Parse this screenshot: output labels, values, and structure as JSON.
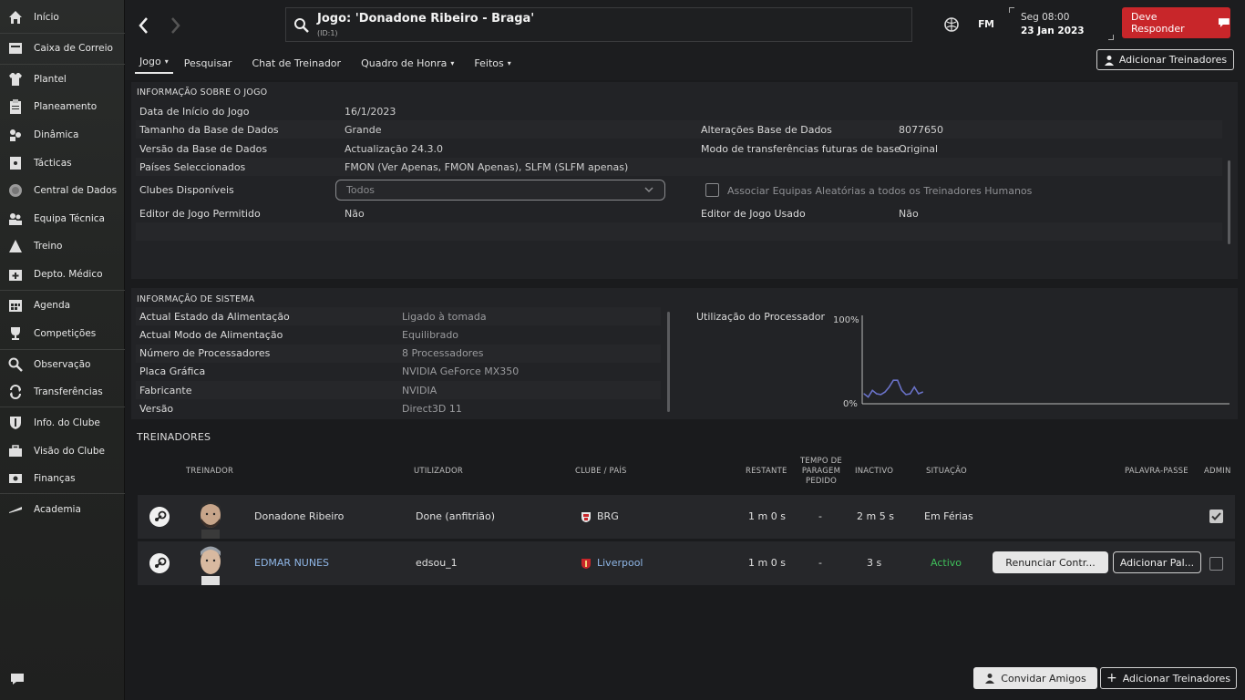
{
  "sidebar": {
    "items": [
      {
        "label": "Início",
        "icon": "home-icon"
      },
      {
        "label": "Caixa de Correio",
        "icon": "inbox-icon"
      },
      {
        "label": "Plantel",
        "icon": "shirt-icon"
      },
      {
        "label": "Planeamento",
        "icon": "clipboard-icon"
      },
      {
        "label": "Dinâmica",
        "icon": "dynamics-icon"
      },
      {
        "label": "Tácticas",
        "icon": "tactics-icon"
      },
      {
        "label": "Central de Dados",
        "icon": "data-icon"
      },
      {
        "label": "Equipa Técnica",
        "icon": "staff-icon"
      },
      {
        "label": "Treino",
        "icon": "training-icon"
      },
      {
        "label": "Depto. Médico",
        "icon": "medical-icon"
      },
      {
        "label": "Agenda",
        "icon": "calendar-icon"
      },
      {
        "label": "Competições",
        "icon": "trophy-icon"
      },
      {
        "label": "Observação",
        "icon": "scouting-icon"
      },
      {
        "label": "Transferências",
        "icon": "transfer-icon"
      },
      {
        "label": "Info. do Clube",
        "icon": "shield-icon"
      },
      {
        "label": "Visão do Clube",
        "icon": "briefcase-icon"
      },
      {
        "label": "Finanças",
        "icon": "money-icon"
      },
      {
        "label": "Academia",
        "icon": "academy-icon"
      }
    ]
  },
  "header": {
    "title": "Jogo: 'Donadone Ribeiro - Braga'",
    "subtitle": "(ID:1)",
    "fm_logo": "FM",
    "date_day": "Seg 08:00",
    "date_full": "23 Jan 2023",
    "respond_label": "Deve Responder",
    "accent_red": "#c8262a"
  },
  "tabs": [
    {
      "label": "Jogo",
      "dropdown": true
    },
    {
      "label": "Pesquisar",
      "dropdown": false
    },
    {
      "label": "Chat de Treinador",
      "dropdown": false
    },
    {
      "label": "Quadro de Honra",
      "dropdown": true
    },
    {
      "label": "Feitos",
      "dropdown": true
    }
  ],
  "add_coaches_top": "Adicionar Treinadores",
  "game_info": {
    "title": "INFORMAÇÃO SOBRE O JOGO",
    "start_date_label": "Data de Início do Jogo",
    "start_date_value": "16/1/2023",
    "db_size_label": "Tamanho da Base de Dados",
    "db_size_value": "Grande",
    "db_changes_label": "Alterações Base de Dados",
    "db_changes_value": "8077650",
    "db_version_label": "Versão da Base de Dados",
    "db_version_value": "Actualização 24.3.0",
    "future_transfers_label": "Modo de transferências futuras de base...",
    "future_transfers_value": "Original",
    "countries_label": "Países Seleccionados",
    "countries_value": "FMON (Ver Apenas, FMON Apenas), SLFM (SLFM apenas)",
    "clubs_label": "Clubes Disponíveis",
    "clubs_value": "Todos",
    "assoc_label": "Associar Equipas Aleatórias a todos os Treinadores Humanos",
    "editor_allowed_label": "Editor de Jogo Permitido",
    "editor_allowed_value": "Não",
    "editor_used_label": "Editor de Jogo Usado",
    "editor_used_value": "Não"
  },
  "system_info": {
    "title": "INFORMAÇÃO DE SISTEMA",
    "rows": [
      {
        "label": "Actual Estado da Alimentação",
        "value": "Ligado à tomada"
      },
      {
        "label": "Actual Modo de Alimentação",
        "value": "Equilibrado"
      },
      {
        "label": "Número de Processadores",
        "value": "8 Processadores"
      },
      {
        "label": "Placa Gráfica",
        "value": "NVIDIA GeForce MX350"
      },
      {
        "label": "Fabricante",
        "value": "NVIDIA"
      },
      {
        "label": "Versão",
        "value": "Direct3D 11"
      }
    ],
    "cpu_label": "Utilização do Processador",
    "cpu_max": "100%",
    "cpu_min": "0%"
  },
  "chart_data": {
    "type": "line",
    "title": "Utilização do Processador",
    "ylim": [
      0,
      100
    ],
    "series": [
      {
        "values": [
          12,
          8,
          16,
          12,
          11,
          14,
          20,
          28,
          28,
          16,
          11,
          12,
          20,
          12,
          14
        ]
      }
    ],
    "line_color": "#6a72c8"
  },
  "coaches": {
    "title": "TREINADORES",
    "headers": {
      "coach": "TREINADOR",
      "user": "UTILIZADOR",
      "club": "CLUBE / PAÍS",
      "remaining": "RESTANTE",
      "pause1": "TEMPO DE",
      "pause2": "PARAGEM",
      "pause3": "PEDIDO",
      "inactive": "INACTIVO",
      "status": "SITUAÇÃO",
      "password": "PALAVRA-PASSE",
      "admin": "ADMIN"
    },
    "rows": [
      {
        "name": "Donadone Ribeiro",
        "user": "Done (anfitrião)",
        "club": "BRG",
        "remaining": "1 m 0 s",
        "pause": "-",
        "inactive": "2 m 5 s",
        "status": "Em Férias",
        "admin": true
      },
      {
        "name": "EDMAR NUNES",
        "user": "edsou_1",
        "club": "Liverpool",
        "remaining": "1 m 0 s",
        "pause": "-",
        "inactive": "3 s",
        "status": "Activo",
        "resign_label": "Renunciar Contr...",
        "password_label": "Adicionar Pal...",
        "admin": false
      }
    ]
  },
  "footer": {
    "invite_label": "Convidar Amigos",
    "add_label": "Adicionar Treinadores"
  }
}
